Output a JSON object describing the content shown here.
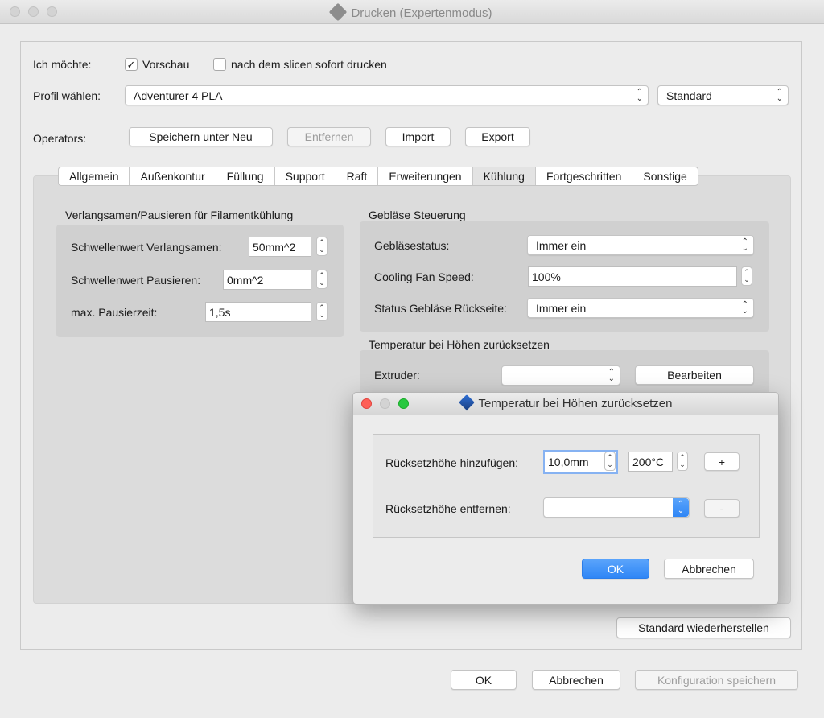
{
  "window": {
    "title": "Drucken (Expertenmodus)"
  },
  "options": {
    "want_label": "Ich möchte:",
    "preview_label": "Vorschau",
    "preview_checked": true,
    "print_after_label": "nach dem slicen sofort drucken",
    "print_after_checked": false
  },
  "profile": {
    "label": "Profil wählen:",
    "value": "Adventurer 4 PLA",
    "mode_value": "Standard"
  },
  "operators": {
    "label": "Operators:",
    "save_as": "Speichern unter Neu",
    "remove": "Entfernen",
    "import": "Import",
    "export": "Export"
  },
  "tabs": [
    {
      "label": "Allgemein",
      "active": false
    },
    {
      "label": "Außenkontur",
      "active": false
    },
    {
      "label": "Füllung",
      "active": false
    },
    {
      "label": "Support",
      "active": false
    },
    {
      "label": "Raft",
      "active": false
    },
    {
      "label": "Erweiterungen",
      "active": false
    },
    {
      "label": "Kühlung",
      "active": true
    },
    {
      "label": "Fortgeschritten",
      "active": false
    },
    {
      "label": "Sonstige",
      "active": false
    }
  ],
  "slowdown": {
    "title": "Verlangsamen/Pausieren für Filamentkühlung",
    "threshold_slow_label": "Schwellenwert Verlangsamen:",
    "threshold_slow_value": "50mm^2",
    "threshold_pause_label": "Schwellenwert Pausieren:",
    "threshold_pause_value": "0mm^2",
    "max_pause_label": "max. Pausierzeit:",
    "max_pause_value": "1,5s"
  },
  "fan": {
    "title": "Gebläse Steuerung",
    "status_label": "Gebläsestatus:",
    "status_value": "Immer ein",
    "speed_label": "Cooling Fan Speed:",
    "speed_value": "100%",
    "rear_label": "Status Gebläse Rückseite:",
    "rear_value": "Immer ein"
  },
  "temp_reset": {
    "title": "Temperatur bei Höhen zurücksetzen",
    "extruder_label": "Extruder:",
    "extruder_value": "",
    "edit_button": "Bearbeiten"
  },
  "restore_button": "Standard wiederherstellen",
  "footer": {
    "ok": "OK",
    "cancel": "Abbrechen",
    "save_config": "Konfiguration speichern"
  },
  "dialog": {
    "title": "Temperatur bei Höhen zurücksetzen",
    "add_label": "Rücksetzhöhe hinzufügen:",
    "height_value": "10,0mm",
    "temp_value": "200°C",
    "plus": "+",
    "remove_label": "Rücksetzhöhe entfernen:",
    "remove_value": "",
    "minus": "-",
    "ok": "OK",
    "cancel": "Abbrechen"
  },
  "colors": {
    "accent": "#2f86f6",
    "close": "#fe5f57",
    "minimize": "#d3d3d3",
    "zoom": "#28c840"
  },
  "icons": {
    "check": "✓",
    "chevron_updown": "⌃⌄"
  }
}
